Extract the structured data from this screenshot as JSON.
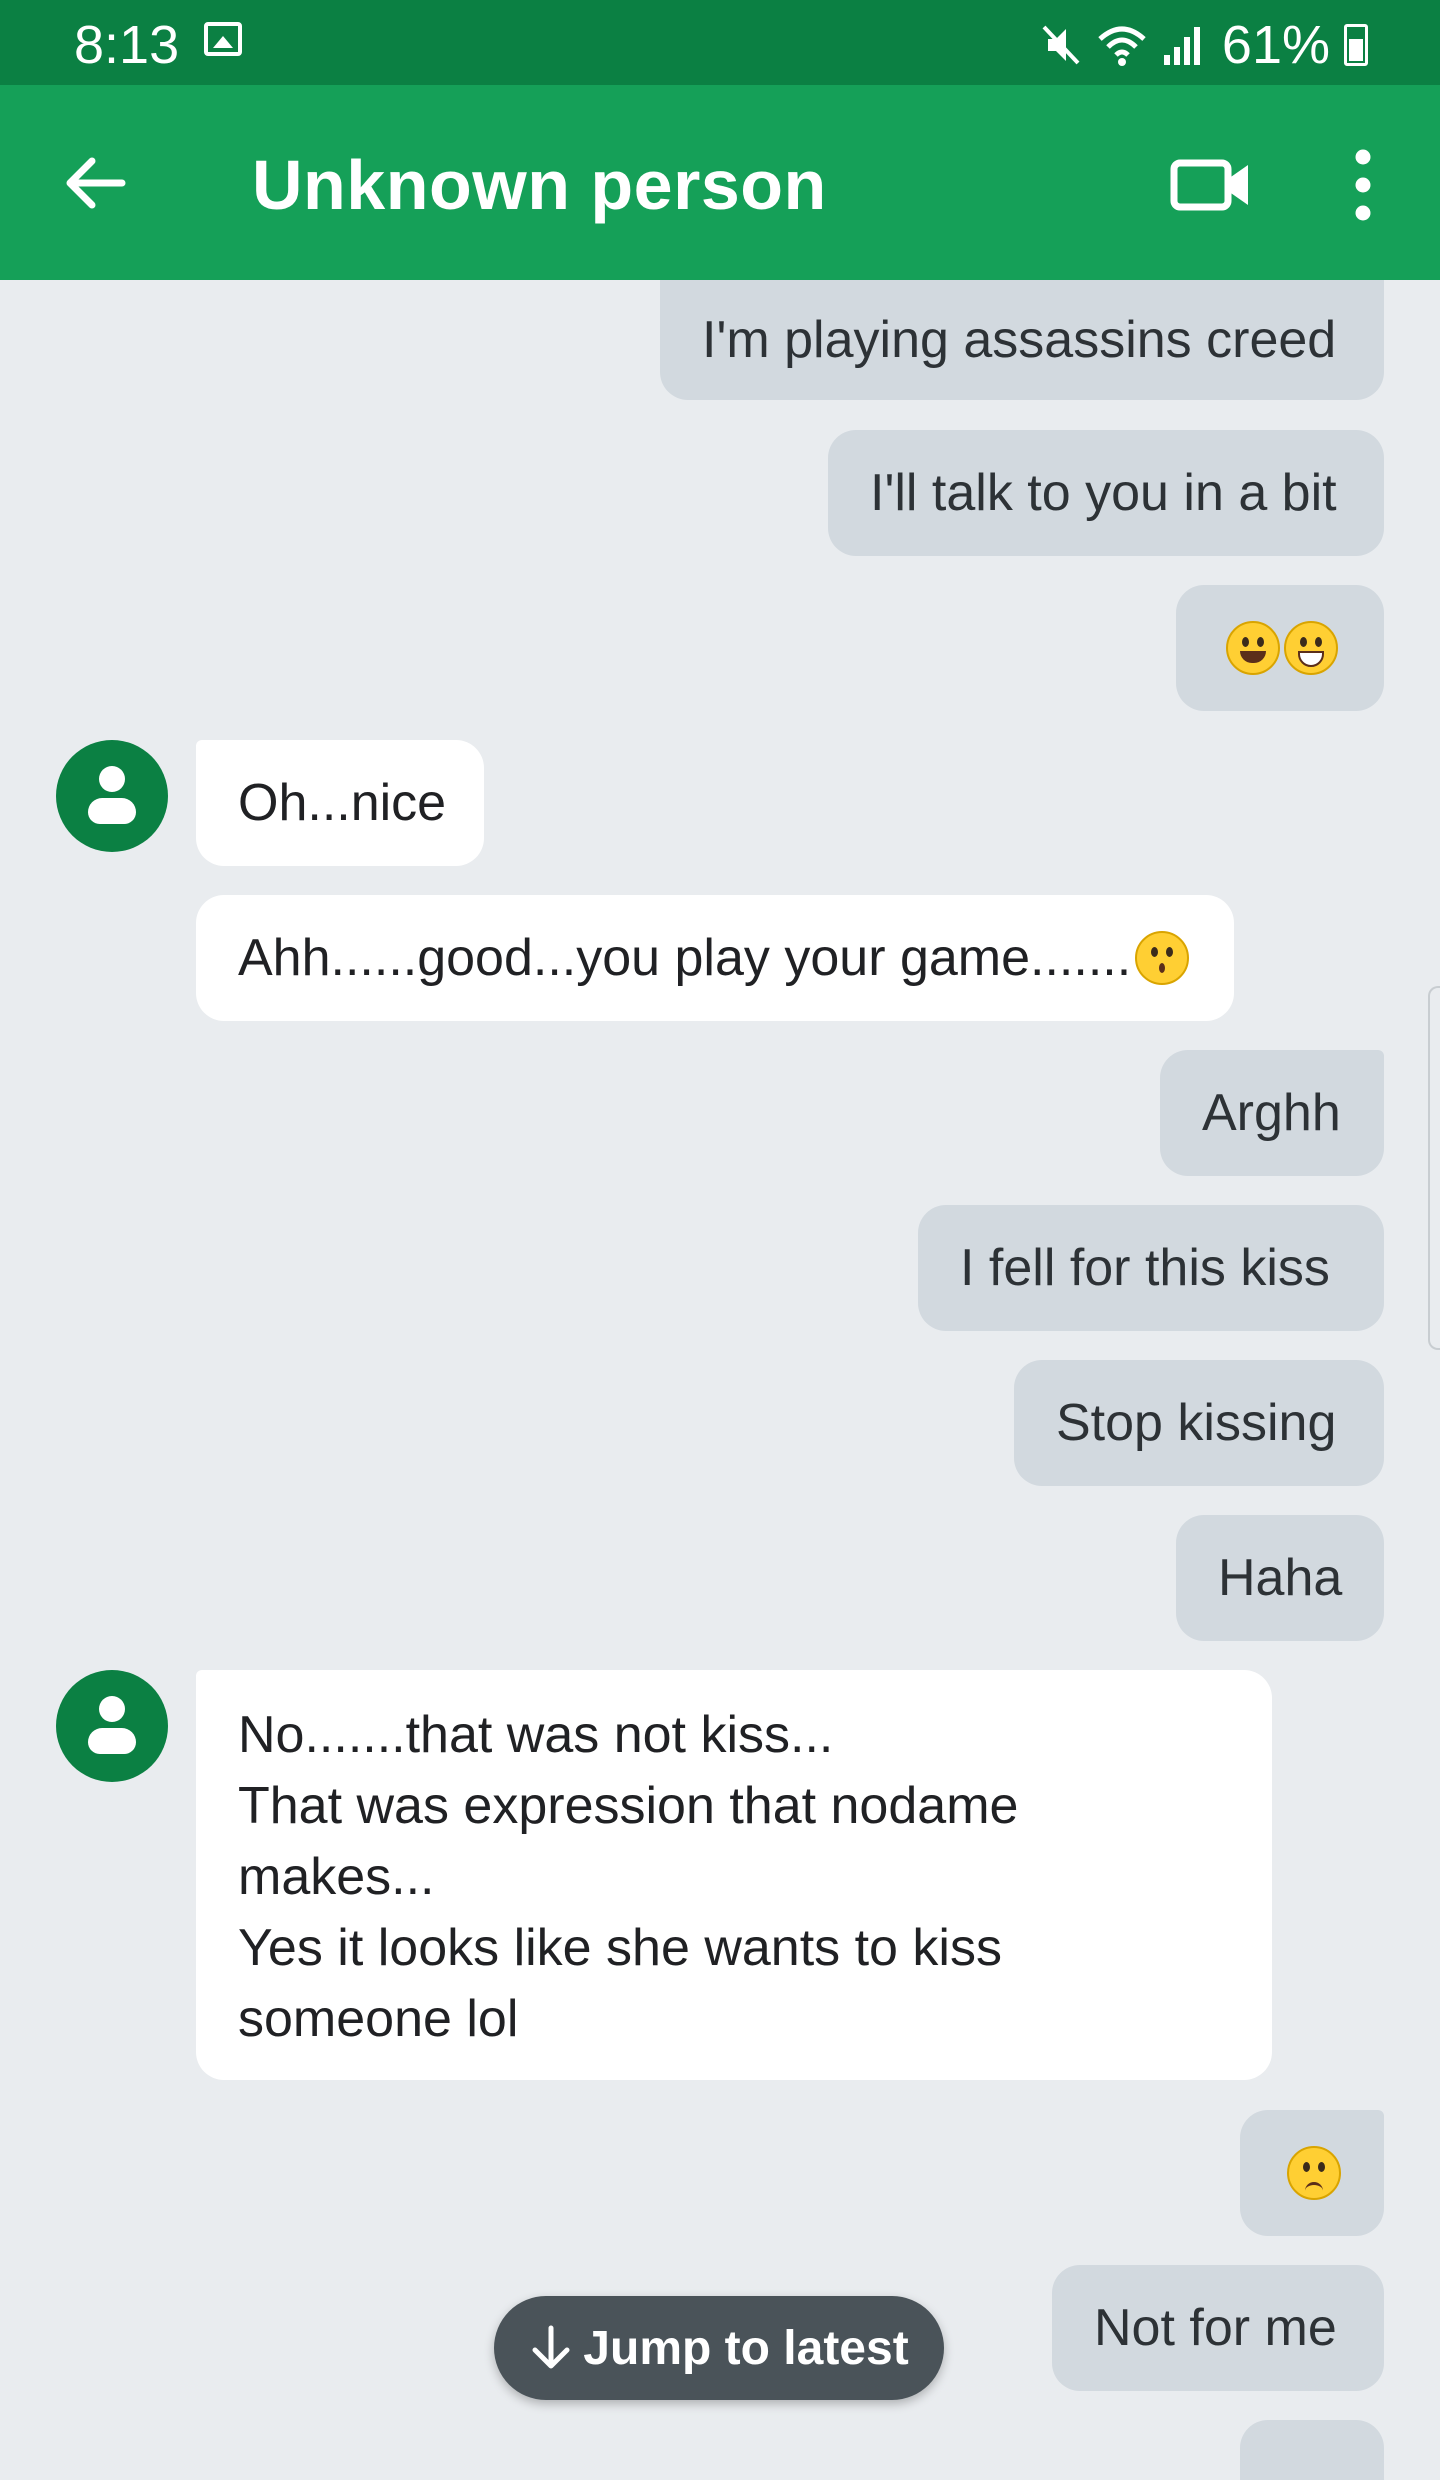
{
  "status_bar": {
    "time": "8:13",
    "battery": "61%",
    "icons": [
      "gallery-icon",
      "mute-icon",
      "wifi-icon",
      "signal-icon",
      "battery-icon"
    ]
  },
  "app_bar": {
    "title": "Unknown person",
    "icons": [
      "back-arrow-icon",
      "video-call-icon",
      "more-vert-icon"
    ]
  },
  "messages": [
    {
      "from": "me",
      "text": "I'm playing assassins creed"
    },
    {
      "from": "me",
      "text": "I'll talk to you in a bit"
    },
    {
      "from": "me",
      "text": "",
      "emoji": [
        "grinning-face",
        "grinning-squint-face"
      ]
    },
    {
      "from": "them",
      "text": "Oh...nice"
    },
    {
      "from": "them",
      "text": "Ahh......good...you play your game.......",
      "emoji": [
        "kissing-face"
      ]
    },
    {
      "from": "me",
      "text": "Arghh"
    },
    {
      "from": "me",
      "text": "I fell for this kiss"
    },
    {
      "from": "me",
      "text": "Stop kissing"
    },
    {
      "from": "me",
      "text": "Haha"
    },
    {
      "from": "them",
      "lines": [
        "No.......that was not kiss...",
        "That was expression that nodame",
        "makes...",
        "Yes it looks like she wants to kiss",
        "someone lol"
      ]
    },
    {
      "from": "me",
      "text": "",
      "emoji": [
        "confused-face"
      ]
    },
    {
      "from": "me",
      "text": "Not for me"
    }
  ],
  "jump_button": {
    "label": "Jump to latest",
    "icon": "arrow-down-icon"
  },
  "colors": {
    "status_bar": "#0b8043",
    "app_bar": "#15a058",
    "avatar": "#0b8043",
    "outgoing_bubble": "#d2d9df",
    "incoming_bubble": "#ffffff",
    "background": "#e9ecef",
    "jump_button": "#4a5359"
  }
}
